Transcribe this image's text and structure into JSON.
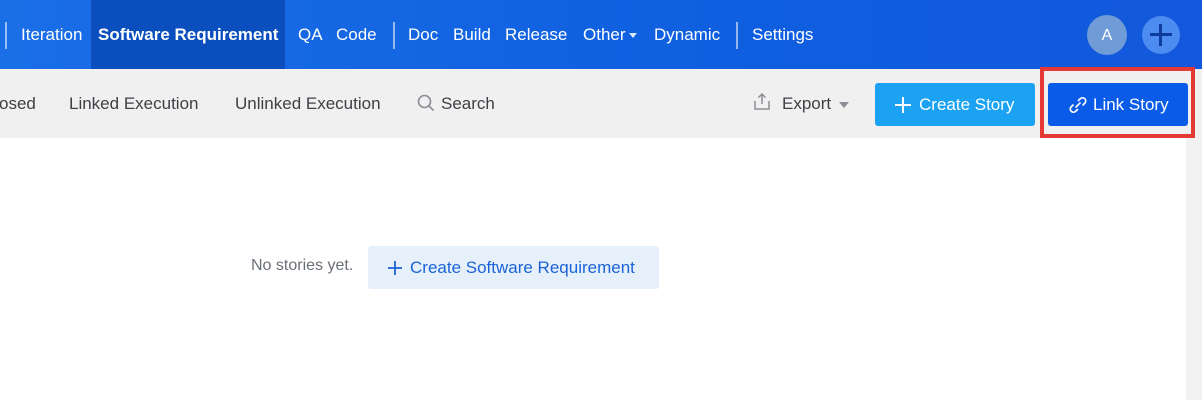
{
  "topnav": {
    "items": [
      {
        "label": "Iteration"
      },
      {
        "label": "Software Requirement",
        "active": true
      },
      {
        "label": "QA"
      },
      {
        "label": "Code"
      },
      {
        "label": "Doc"
      },
      {
        "label": "Build"
      },
      {
        "label": "Release"
      },
      {
        "label": "Other"
      },
      {
        "label": "Dynamic"
      },
      {
        "label": "Settings"
      }
    ],
    "avatar_initial": "A",
    "add_icon": "plus-icon"
  },
  "toolbar": {
    "tabs": [
      {
        "label": "osed"
      },
      {
        "label": "Linked Execution"
      },
      {
        "label": "Unlinked Execution"
      }
    ],
    "search_label": "Search",
    "export_label": "Export",
    "create_story_label": "Create Story",
    "link_story_label": "Link Story"
  },
  "empty_state": {
    "message": "No stories yet.",
    "create_label": "Create Software Requirement"
  },
  "colors": {
    "nav_bg": "#1a6ee6",
    "nav_active": "#0b4fbf",
    "create_btn": "#1ba2f2",
    "link_btn": "#0a5ce8",
    "highlight": "#e53935"
  }
}
